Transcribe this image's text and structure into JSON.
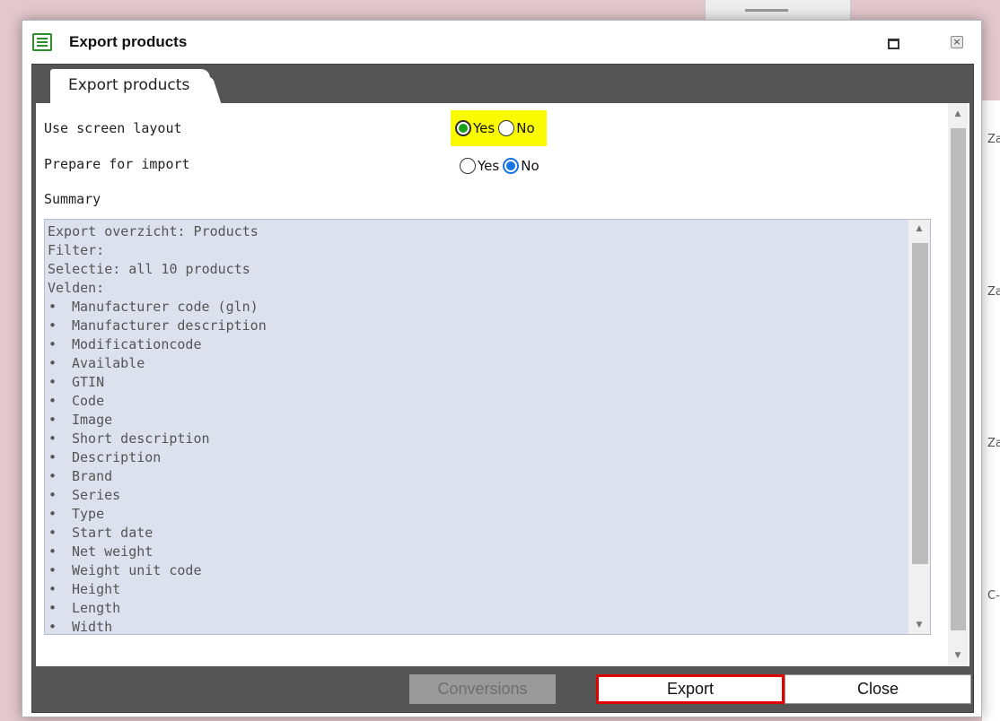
{
  "window": {
    "title": "Export products"
  },
  "tab": {
    "label": "Export products"
  },
  "options": {
    "use_screen_layout": {
      "label": "Use screen layout",
      "yes_label": "Yes",
      "no_label": "No",
      "selected": "Yes",
      "highlight_color": "#fafa00"
    },
    "prepare_for_import": {
      "label": "Prepare for import",
      "yes_label": "Yes",
      "no_label": "No",
      "selected": "No"
    }
  },
  "summary": {
    "label": "Summary",
    "header_lines": [
      "Export overzicht: Products",
      "Filter:",
      "Selectie: all 10 products",
      "Velden:"
    ],
    "fields": [
      "Manufacturer code (gln)",
      "Manufacturer description",
      "Modificationcode",
      "Available",
      "GTIN",
      "Code",
      "Image",
      "Short description",
      "Description",
      "Brand",
      "Series",
      "Type",
      "Start date",
      "Net weight",
      "Weight unit code",
      "Height",
      "Length",
      "Width"
    ],
    "bullet": "•"
  },
  "buttons": {
    "conversions": "Conversions",
    "export": "Export",
    "close": "Close"
  },
  "background": {
    "right_edge_fragments": [
      "Za",
      "Za",
      "Za",
      "C-"
    ]
  },
  "colors": {
    "frame": "#555555",
    "summary_bg": "#dde1ee",
    "export_border": "#e00000",
    "radio_green": "#18a018",
    "radio_blue": "#1673e6"
  }
}
